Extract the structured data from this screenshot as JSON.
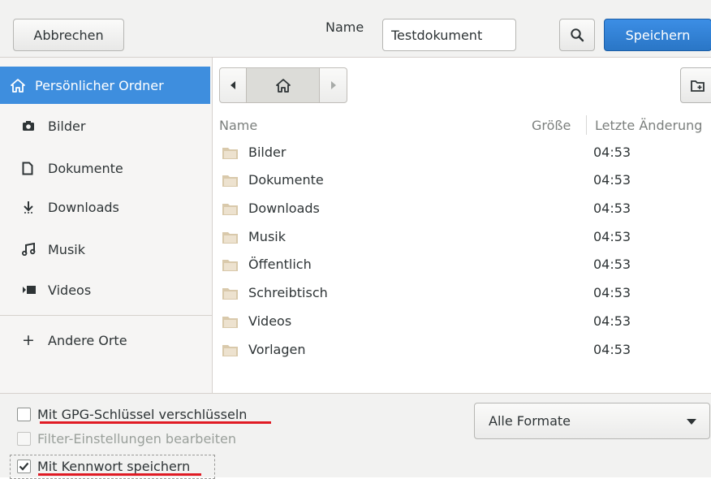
{
  "header": {
    "cancel_label": "Abbrechen",
    "name_label": "Name",
    "name_value": "Testdokument",
    "save_label": "Speichern"
  },
  "sidebar": {
    "items": [
      {
        "label": "Persönlicher Ordner",
        "icon": "home-icon"
      },
      {
        "label": "Bilder",
        "icon": "camera-icon"
      },
      {
        "label": "Dokumente",
        "icon": "document-icon"
      },
      {
        "label": "Downloads",
        "icon": "download-icon"
      },
      {
        "label": "Musik",
        "icon": "music-icon"
      },
      {
        "label": "Videos",
        "icon": "video-icon"
      },
      {
        "label": "Andere Orte",
        "icon": "plus-icon"
      }
    ]
  },
  "columns": {
    "name": "Name",
    "size": "Größe",
    "modified": "Letzte Änderung"
  },
  "files": [
    {
      "name": "Bilder",
      "modified": "04:53"
    },
    {
      "name": "Dokumente",
      "modified": "04:53"
    },
    {
      "name": "Downloads",
      "modified": "04:53"
    },
    {
      "name": "Musik",
      "modified": "04:53"
    },
    {
      "name": "Öffentlich",
      "modified": "04:53"
    },
    {
      "name": "Schreibtisch",
      "modified": "04:53"
    },
    {
      "name": "Videos",
      "modified": "04:53"
    },
    {
      "name": "Vorlagen",
      "modified": "04:53"
    }
  ],
  "options": {
    "gpg_label": "Mit GPG-Schlüssel verschlüsseln",
    "gpg_checked": false,
    "filter_label": "Filter-Einstellungen bearbeiten",
    "filter_checked": false,
    "filter_enabled": false,
    "password_label": "Mit Kennwort speichern",
    "password_checked": true,
    "format_selected": "Alle Formate"
  },
  "colors": {
    "accent": "#3e8ede",
    "annotation_underline": "#e01b24",
    "folder": "#d9c9ab"
  }
}
